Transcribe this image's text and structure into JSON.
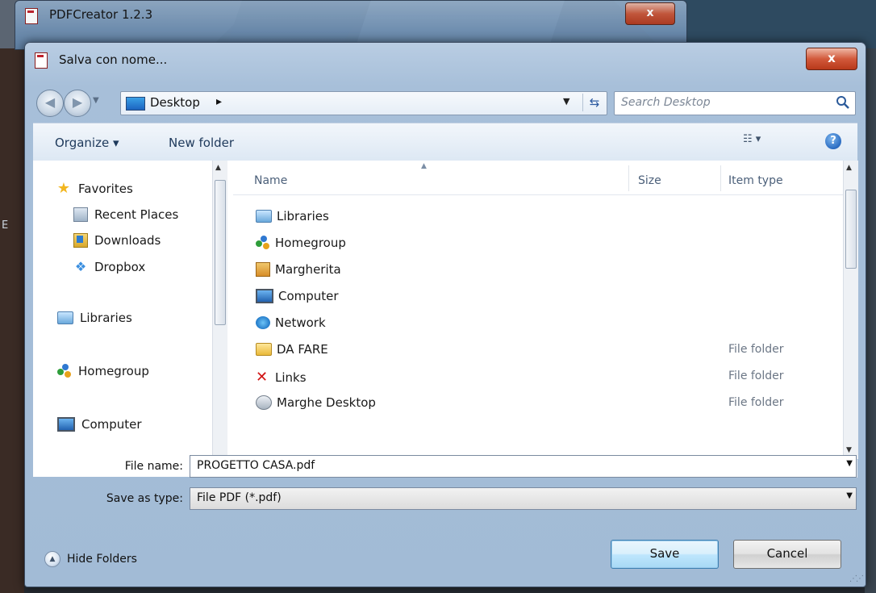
{
  "background_window": {
    "title": "PDFCreator 1.2.3",
    "close_label": "x"
  },
  "dialog": {
    "title": "Salva con nome...",
    "close_label": "x"
  },
  "address_bar": {
    "location": "Desktop",
    "separator": "▸"
  },
  "search": {
    "placeholder": "Search Desktop"
  },
  "toolbar": {
    "organize_label": "Organize ▾",
    "new_folder_label": "New folder",
    "help_label": "?"
  },
  "nav_pane": {
    "items": [
      {
        "label": "Favorites",
        "icon": "star-icon"
      },
      {
        "label": "Recent Places",
        "icon": "recent-places-icon"
      },
      {
        "label": "Downloads",
        "icon": "downloads-icon"
      },
      {
        "label": "Dropbox",
        "icon": "dropbox-icon"
      },
      {
        "label": "Libraries",
        "icon": "libraries-icon"
      },
      {
        "label": "Homegroup",
        "icon": "homegroup-icon"
      },
      {
        "label": "Computer",
        "icon": "computer-icon"
      }
    ]
  },
  "file_list": {
    "columns": {
      "name": "Name",
      "size": "Size",
      "type": "Item type"
    },
    "rows": [
      {
        "name": "Libraries",
        "type": "",
        "icon": "libraries-icon"
      },
      {
        "name": "Homegroup",
        "type": "",
        "icon": "homegroup-icon"
      },
      {
        "name": "Margherita",
        "type": "",
        "icon": "user-folder-icon"
      },
      {
        "name": "Computer",
        "type": "",
        "icon": "computer-icon"
      },
      {
        "name": "Network",
        "type": "",
        "icon": "network-icon"
      },
      {
        "name": "DA FARE",
        "type": "File folder",
        "icon": "folder-icon"
      },
      {
        "name": "Links",
        "type": "File folder",
        "icon": "links-icon"
      },
      {
        "name": "Marghe Desktop",
        "type": "File folder",
        "icon": "shortcut-folder-icon"
      }
    ]
  },
  "fields": {
    "file_name_label": "File name:",
    "file_name_value": "PROGETTO CASA.pdf",
    "save_type_label": "Save as type:",
    "save_type_value": "File PDF (*.pdf)"
  },
  "footer": {
    "hide_folders_label": "Hide Folders",
    "save_label": "Save",
    "cancel_label": "Cancel"
  }
}
